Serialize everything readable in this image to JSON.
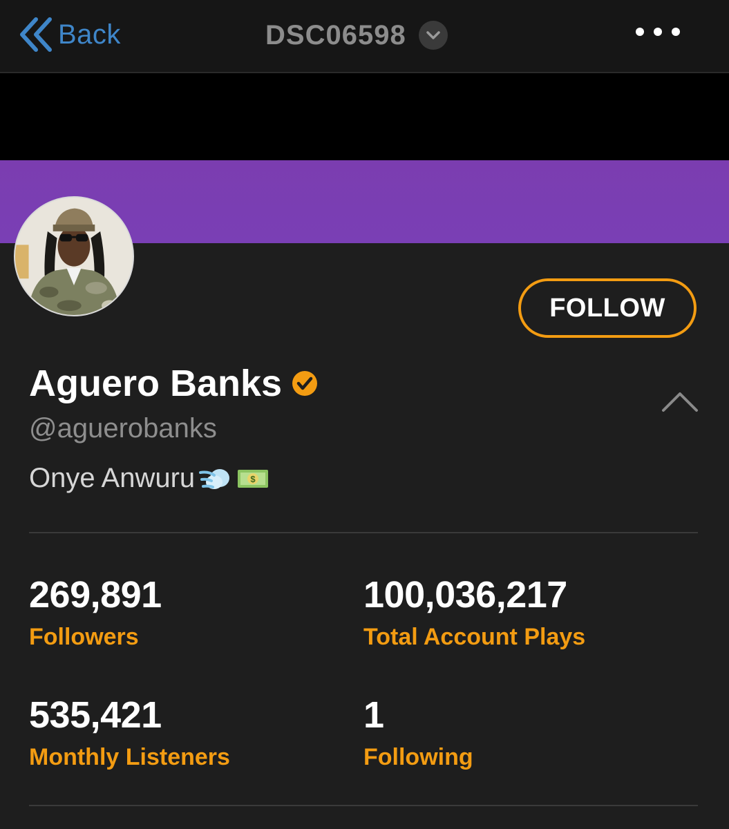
{
  "header": {
    "back_label": "Back",
    "title": "DSC06598"
  },
  "profile": {
    "name": "Aguero Banks",
    "handle": "@aguerobanks",
    "bio": "Onye Anwuru",
    "bio_emojis": [
      "dashing-away-emoji",
      "dollar-banknote-emoji"
    ],
    "follow_label": "FOLLOW"
  },
  "stats": [
    {
      "value": "269,891",
      "label": "Followers"
    },
    {
      "value": "100,036,217",
      "label": "Total Account Plays"
    },
    {
      "value": "535,421",
      "label": "Monthly Listeners"
    },
    {
      "value": "1",
      "label": "Following"
    }
  ],
  "colors": {
    "accent": "#f39c12",
    "banner": "#7b3db0",
    "link": "#3f86c9",
    "background": "#1e1e1e"
  }
}
